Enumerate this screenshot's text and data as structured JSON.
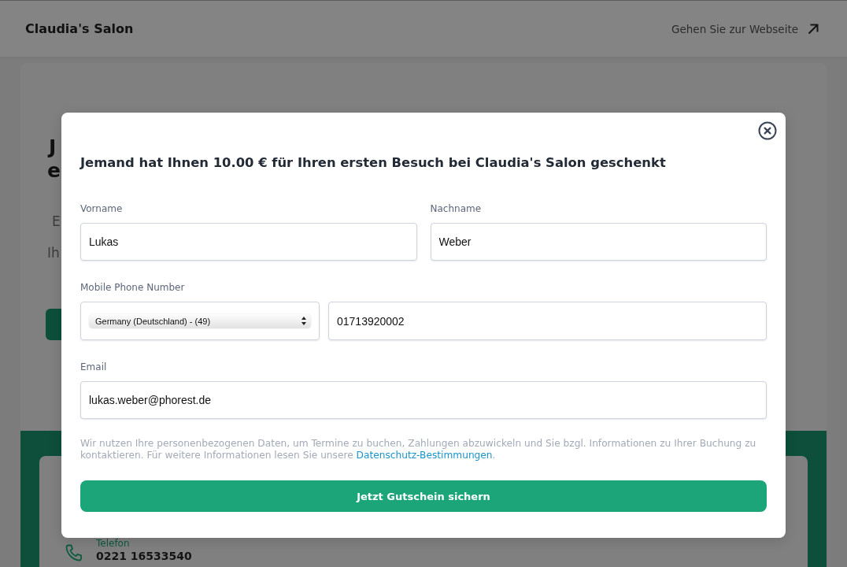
{
  "header": {
    "title": "Claudia's Salon",
    "website_link": "Gehen Sie zur Webseite"
  },
  "background_page": {
    "heading_lines": [
      "J",
      "e"
    ],
    "text_lines": [
      "E",
      "Ih"
    ],
    "contact": {
      "label": "Telefon",
      "value": "0221 16533540"
    }
  },
  "dialog": {
    "title": "Jemand hat Ihnen 10.00 € für Ihren ersten Besuch bei Claudia's Salon geschenkt",
    "name_fields": [
      {
        "label": "Vorname",
        "value": "Lukas"
      },
      {
        "label": "Nachname",
        "value": "Weber"
      }
    ],
    "phone": {
      "label": "Mobile Phone Number",
      "country": "Germany (Deutschland) - (49)",
      "value": "01713920002"
    },
    "email": {
      "label": "Email",
      "value": "lukas.weber@phorest.de"
    },
    "privacy": {
      "text": "Wir nutzen Ihre personenbezogenen Daten, um Termine zu buchen, Zahlungen abzuwickeln und Sie bzgl. Informationen zu Ihrer Buchung zu kontaktieren. Für weitere Informationen lesen Sie unsere",
      "link": "Datenschutz-Bestimmungen",
      "after": "."
    },
    "submit_button": "Jetzt Gutschein sichern"
  }
}
